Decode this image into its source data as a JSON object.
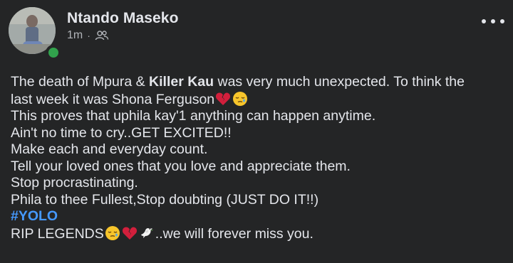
{
  "author": {
    "name": "Ntando Maseko",
    "time": "1m",
    "separator": "·"
  },
  "post": {
    "line1_a": "The death of Mpura & ",
    "line1_bold": "Killer Kau",
    "line1_b": " was very much unexpected. To think the",
    "line2": "last week it was Shona Ferguson",
    "line3": "This proves that uphila kay'1 anything can happen anytime.",
    "line4": "Ain't no time to cry..GET EXCITED!!",
    "line5": "Make each and everyday count.",
    "line6": "Tell your loved ones that you love and appreciate them.",
    "line7": "Stop procrastinating.",
    "line8": "Phila to thee Fullest,Stop doubting (JUST DO IT!!)",
    "hashtag": "#YOLO",
    "line10_a": "RIP LEGENDS",
    "line10_b": "..we will forever miss you."
  },
  "icons": {
    "audience": "friends-icon",
    "more": "more-options-icon",
    "emojis": [
      "broken-heart-emoji",
      "sleepy-face-emoji",
      "dove-emoji"
    ]
  },
  "colors": {
    "background": "#242526",
    "text": "#e4e6eb",
    "secondary_text": "#b0b3b8",
    "hashtag": "#4599ff",
    "online": "#31a24c",
    "broken_heart": "#d21f3c",
    "emoji_face": "#f7c52b"
  }
}
